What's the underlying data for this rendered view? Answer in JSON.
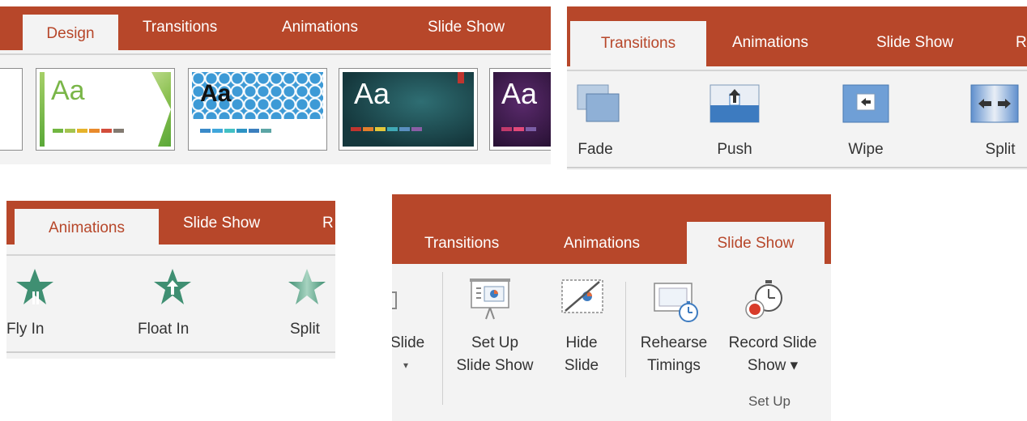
{
  "design_panel": {
    "tabs": [
      "Design",
      "Transitions",
      "Animations",
      "Slide Show"
    ],
    "active_tab": "Design",
    "themes": [
      {
        "preview": "Aa",
        "color": "#7ab648",
        "swatches": [
          "#71b641",
          "#a4c44f",
          "#e6b32b",
          "#e98a2c",
          "#d24d3b",
          "#837a71"
        ]
      },
      {
        "preview": "Aa",
        "color": "#111111",
        "swatches": [
          "#3a8ac9",
          "#3fa6db",
          "#42c0c4",
          "#2d93c4",
          "#3b7fbe",
          "#5ca5a5"
        ]
      },
      {
        "preview": "Aa",
        "color": "#ffffff",
        "swatches": [
          "#c0352f",
          "#e47e2c",
          "#e4c73a",
          "#40a9b6",
          "#5a8fc0",
          "#8a5ea6"
        ]
      },
      {
        "preview": "Aa",
        "color": "#ffffff",
        "swatches": [
          "#c13a6b",
          "#e24a7a",
          "#7b5ea6"
        ]
      }
    ]
  },
  "transitions_panel": {
    "tabs": [
      "Transitions",
      "Animations",
      "Slide Show",
      "R"
    ],
    "active_tab": "Transitions",
    "effects": [
      {
        "label": "Fade",
        "icon": "fade-icon"
      },
      {
        "label": "Push",
        "icon": "push-icon"
      },
      {
        "label": "Wipe",
        "icon": "wipe-icon"
      },
      {
        "label": "Split",
        "icon": "split-icon"
      }
    ]
  },
  "animations_panel": {
    "tabs": [
      "Animations",
      "Slide Show",
      "R"
    ],
    "active_tab": "Animations",
    "effects": [
      {
        "label": "Fly In",
        "icon": "fly-in-star-icon"
      },
      {
        "label": "Float In",
        "icon": "float-in-star-icon"
      },
      {
        "label": "Split",
        "icon": "split-star-icon"
      }
    ]
  },
  "slideshow_panel": {
    "tabs": [
      "Transitions",
      "Animations",
      "Slide Show"
    ],
    "active_tab": "Slide Show",
    "partial_button": {
      "label": "Slide",
      "arrow": "▾"
    },
    "buttons": [
      {
        "line1": "Set Up",
        "line2": "Slide Show",
        "icon": "set-up-slide-show-icon"
      },
      {
        "line1": "Hide",
        "line2": "Slide",
        "icon": "hide-slide-icon"
      },
      {
        "line1": "Rehearse",
        "line2": "Timings",
        "icon": "rehearse-timings-icon"
      },
      {
        "line1": "Record Slide",
        "line2": "Show ▾",
        "icon": "record-slide-show-icon"
      }
    ],
    "group_label": "Set Up"
  },
  "colors": {
    "accent": "#b7472a",
    "ribbon": "#f3f3f3",
    "star": "#3f8f72"
  }
}
